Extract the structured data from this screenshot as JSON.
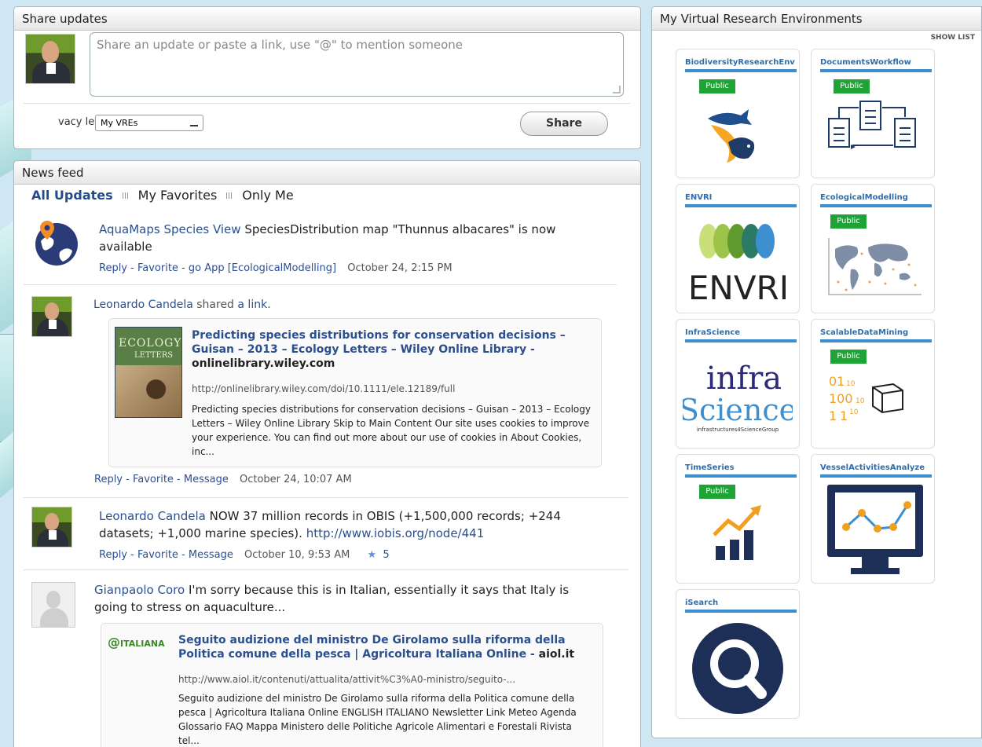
{
  "share": {
    "header": "Share updates",
    "placeholder": "Share an update or paste a link, use \"@\" to mention someone",
    "privacy_label": "vacy level:",
    "privacy_value": "My VREs",
    "share_button": "Share"
  },
  "news": {
    "header": "News feed",
    "filters": [
      "All Updates",
      "My Favorites",
      "Only Me"
    ],
    "posts": [
      {
        "author": "AquaMaps Species View",
        "text": "SpeciesDistribution map \"Thunnus albacares\" is now available",
        "actions": "Reply - Favorite - go App [EcologicalModelling]",
        "date": "October 24, 2:15 PM"
      },
      {
        "author": "Leonardo Candela",
        "text": "shared",
        "link_word": "a link.",
        "link_title": "Predicting species distributions for conservation decisions – Guisan – 2013 – Ecology Letters – Wiley Online Library",
        "link_host": "onlinelibrary.wiley.com",
        "link_url": "http://onlinelibrary.wiley.com/doi/10.1111/ele.12189/full",
        "link_desc": "Predicting species distributions for conservation decisions – Guisan – 2013 – Ecology Letters – Wiley Online Library Skip to Main Content Our site uses cookies to improve your experience. You can find out more about our use of cookies in About Cookies, inc...",
        "book_title": "ECOLOGY",
        "book_subtitle": "LETTERS",
        "actions": "Reply - Favorite - Message",
        "date": "October 24, 10:07 AM"
      },
      {
        "author": "Leonardo Candela",
        "text": "NOW 37 million records in OBIS (+1,500,000 records; +244 datasets; +1,000 marine species).",
        "link": "http://www.iobis.org/node/441",
        "actions": "Reply - Favorite - Message",
        "date": "October 10, 9:53 AM",
        "likes": "5"
      },
      {
        "author": "Gianpaolo Coro",
        "text": "I'm sorry because this is in Italian, essentially it says that Italy is going to stress on aquaculture...",
        "logo_text": "ITALIANA",
        "link_title": "Seguito audizione del ministro De Girolamo sulla riforma della Politica comune della pesca | Agricoltura Italiana Online",
        "link_host": "aiol.it",
        "link_url": "http://www.aiol.it/contenuti/attualita/attivit%C3%A0-ministro/seguito-...",
        "link_desc": "Seguito audizione del ministro De Girolamo sulla riforma della Politica comune della pesca | Agricoltura Italiana Online ENGLISH ITALIANO Newsletter Link Meteo Agenda Glossario FAQ Mappa Ministero delle Politiche Agricole Alimentari e Forestali Rivista tel..."
      }
    ]
  },
  "vre": {
    "header": "My Virtual Research Environments",
    "show_list": "SHOW LIST",
    "badge": "Public",
    "tiles": [
      {
        "name": "BiodiversityResearchEnv",
        "public": true,
        "icon": "fish-icon"
      },
      {
        "name": "DocumentsWorkflow",
        "public": true,
        "icon": "workflow-icon"
      },
      {
        "name": "ENVRI",
        "public": false,
        "icon": "envri-logo"
      },
      {
        "name": "EcologicalModelling",
        "public": true,
        "icon": "world-map-icon"
      },
      {
        "name": "InfraScience",
        "public": false,
        "icon": "infrascience-logo"
      },
      {
        "name": "ScalableDataMining",
        "public": true,
        "icon": "data-mining-icon"
      },
      {
        "name": "TimeSeries",
        "public": true,
        "icon": "chart-icon"
      },
      {
        "name": "VesselActivitiesAnalyze",
        "public": false,
        "icon": "monitor-chart-icon"
      },
      {
        "name": "iSearch",
        "public": false,
        "icon": "search-icon"
      }
    ],
    "envri_text": "ENVRI",
    "infra_text": "infra",
    "science_text": "Science",
    "infra_sub": "infrastructures4ScienceGroup"
  },
  "colors": {
    "accent": "#2b4f8f",
    "public_badge": "#1fa336",
    "tile_bar": "#3b8ed0",
    "vre_navy": "#1d2f57"
  }
}
